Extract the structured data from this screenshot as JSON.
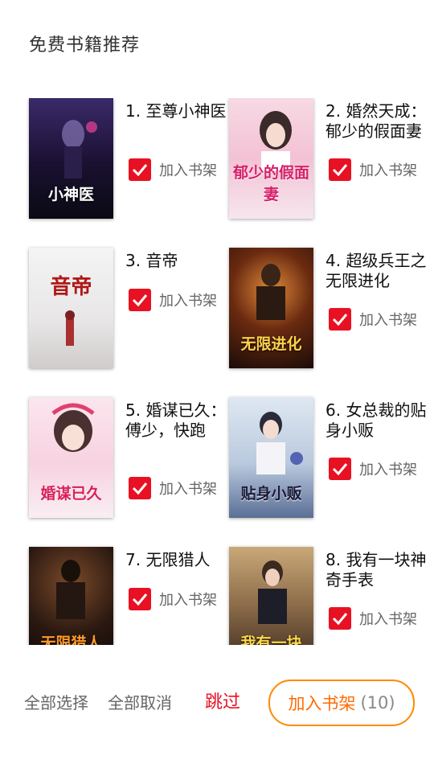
{
  "header": {
    "title": "免费书籍推荐"
  },
  "books": [
    {
      "title": "1. 至尊小神医",
      "add_label": "加入书架",
      "checked": true,
      "cover_text": "小神医"
    },
    {
      "title": "2. 婚然天成：郁少的假面妻",
      "add_label": "加入书架",
      "checked": true,
      "cover_text": "郁少的假面妻"
    },
    {
      "title": "3. 音帝",
      "add_label": "加入书架",
      "checked": true,
      "cover_text": "音帝"
    },
    {
      "title": "4. 超级兵王之无限进化",
      "add_label": "加入书架",
      "checked": true,
      "cover_text": "无限进化"
    },
    {
      "title": "5. 婚谋已久：傅少，快跑",
      "add_label": "加入书架",
      "checked": true,
      "cover_text": "婚谋已久"
    },
    {
      "title": "6. 女总裁的贴身小贩",
      "add_label": "加入书架",
      "checked": true,
      "cover_text": "贴身小贩"
    },
    {
      "title": "7. 无限猎人",
      "add_label": "加入书架",
      "checked": true,
      "cover_text": "无限猎人"
    },
    {
      "title": "8. 我有一块神奇手表",
      "add_label": "加入书架",
      "checked": true,
      "cover_text": "我有一块"
    }
  ],
  "footer": {
    "select_all": "全部选择",
    "deselect_all": "全部取消",
    "skip": "跳过",
    "confirm_label": "加入书架",
    "confirm_count": "(10)"
  },
  "colors": {
    "check": "#e81123",
    "skip": "#e81123",
    "confirm_border": "#ff8a00",
    "confirm_text": "#ff6a00"
  }
}
